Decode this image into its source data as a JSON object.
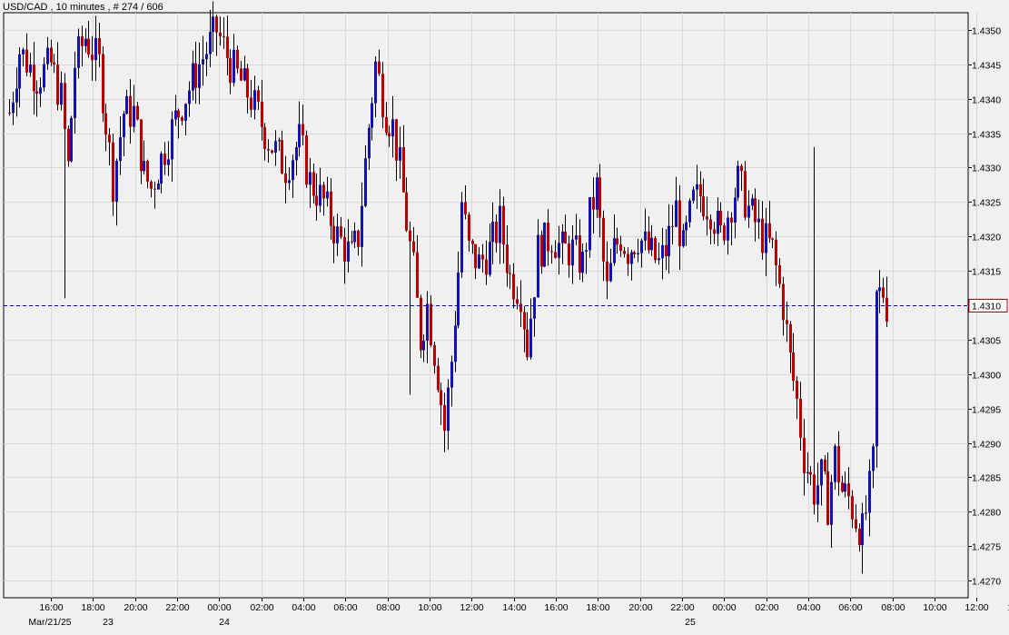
{
  "header": {
    "title": "USD/CAD , 10 minutes , # 274 / 606"
  },
  "colors": {
    "up": "#1212b8",
    "down": "#c00000",
    "background": "#f0f0f0",
    "grid": "#d8d8d8",
    "current_line": "#0000ff",
    "current_box_border": "#c00000",
    "current_text": "#c00000"
  },
  "chart_data": {
    "type": "candlestick",
    "title": "USD/CAD , 10 minutes , # 274 / 606",
    "ylim": [
      1.42675,
      1.43525
    ],
    "yticks": [
      "1.4350",
      "1.4345",
      "1.4340",
      "1.4335",
      "1.4330",
      "1.4325",
      "1.4320",
      "1.4315",
      "1.4310",
      "1.4305",
      "1.4300",
      "1.4295",
      "1.4290",
      "1.4285",
      "1.4280",
      "1.4275",
      "1.4270"
    ],
    "xticks": [
      "16:00",
      "18:00",
      "20:00",
      "22:00",
      "00:00",
      "02:00",
      "04:00",
      "06:00",
      "08:00",
      "10:00",
      "12:00",
      "14:00",
      "16:00",
      "18:00",
      "20:00",
      "22:00",
      "00:00",
      "02:00",
      "04:00",
      "06:00",
      "08:00",
      "10:00",
      "12:00",
      "14:00"
    ],
    "date_labels": [
      "Mar/21/25",
      "23",
      "24",
      "25"
    ],
    "current_price": "1.4310",
    "grid": true,
    "key_points": [
      {
        "time": "Mar/21 16:00",
        "price": 1.4345
      },
      {
        "time": "Mar/21 16:40",
        "low": 1.4311
      },
      {
        "time": "Mar/23 18:00",
        "price": 1.4331
      },
      {
        "time": "Mar/24 00:00",
        "price": 1.435
      },
      {
        "time": "Mar/24 04:00",
        "price": 1.433
      },
      {
        "time": "Mar/24 08:00",
        "price": 1.4318
      },
      {
        "time": "Mar/24 08:20",
        "price": 1.4345
      },
      {
        "time": "Mar/24 11:50",
        "low": 1.4289
      },
      {
        "time": "Mar/24 13:00",
        "price": 1.4325
      },
      {
        "time": "Mar/24 17:00",
        "low": 1.4302
      },
      {
        "time": "Mar/24 21:00",
        "price": 1.4327
      },
      {
        "time": "Mar/25 02:00",
        "price": 1.4318
      },
      {
        "time": "Mar/25 03:40",
        "price": 1.4328
      },
      {
        "time": "Mar/25 04:30",
        "high": 1.4333
      },
      {
        "time": "Mar/25 06:00",
        "price": 1.4318
      },
      {
        "time": "Mar/25 07:00",
        "price": 1.429
      },
      {
        "time": "Mar/25 09:40",
        "low": 1.4271
      },
      {
        "time": "Mar/25 10:10",
        "price": 1.431
      }
    ]
  }
}
